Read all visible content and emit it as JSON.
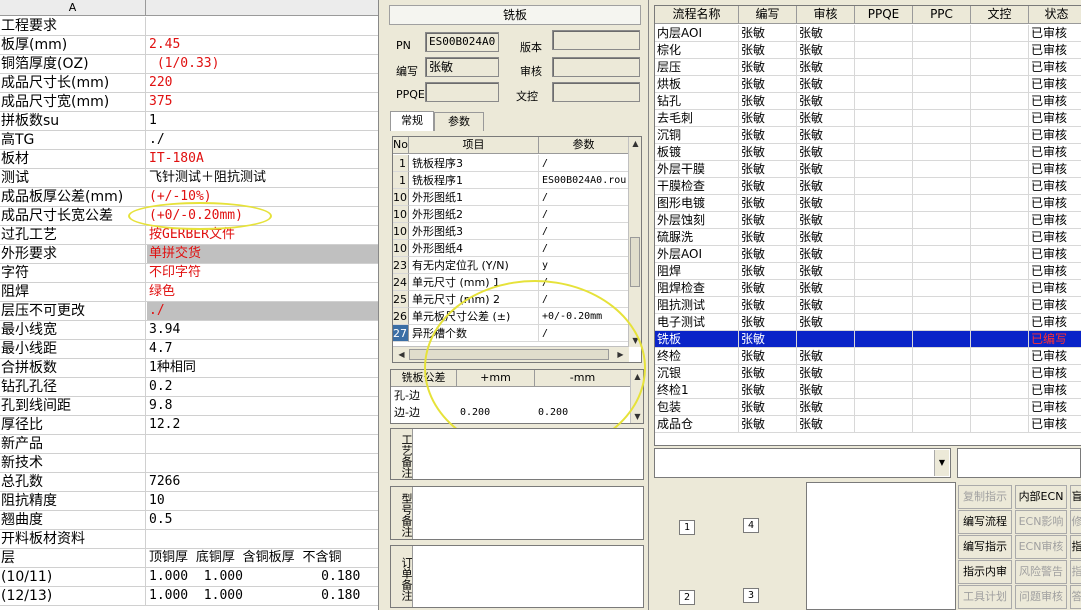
{
  "sheet": {
    "col_header": "A",
    "rows": [
      {
        "k": "工程要求",
        "v": "",
        "style": ""
      },
      {
        "k": "板厚(mm)",
        "v": "2.45",
        "style": "red"
      },
      {
        "k": "铜箔厚度(OZ)",
        "v": " (1/0.33)",
        "style": "red"
      },
      {
        "k": "成品尺寸长(mm)",
        "v": "220",
        "style": "red"
      },
      {
        "k": "成品尺寸宽(mm)",
        "v": "375",
        "style": "red"
      },
      {
        "k": "拼板数su",
        "v": "1",
        "style": ""
      },
      {
        "k": "高TG",
        "v": "./",
        "style": ""
      },
      {
        "k": "板材",
        "v": "IT-180A",
        "style": "red"
      },
      {
        "k": "测试",
        "v": "飞针测试＋阻抗测试",
        "style": ""
      },
      {
        "k": "成品板厚公差(mm)",
        "v": "(+/-10%)",
        "style": "red"
      },
      {
        "k": "成品尺寸长宽公差",
        "v": "(+0/-0.20mm)",
        "style": "red"
      },
      {
        "k": "过孔工艺",
        "v": "按GERBER文件",
        "style": "red"
      },
      {
        "k": "外形要求",
        "v": "单拼交货",
        "style": "red gray"
      },
      {
        "k": "字符",
        "v": "不印字符",
        "style": "red"
      },
      {
        "k": "阻焊",
        "v": "绿色",
        "style": "red"
      },
      {
        "k": "层压不可更改",
        "v": "./",
        "style": "red gray"
      },
      {
        "k": "最小线宽",
        "v": "3.94",
        "style": ""
      },
      {
        "k": "最小线距",
        "v": "4.7",
        "style": ""
      },
      {
        "k": "合拼板数",
        "v": "1种相同",
        "style": ""
      },
      {
        "k": "钻孔孔径",
        "v": "0.2",
        "style": ""
      },
      {
        "k": "孔到线间距",
        "v": "9.8",
        "style": ""
      },
      {
        "k": "厚径比",
        "v": "12.2",
        "style": ""
      },
      {
        "k": "新产品",
        "v": "",
        "style": ""
      },
      {
        "k": "新技术",
        "v": "",
        "style": ""
      },
      {
        "k": "总孔数",
        "v": "7266",
        "style": ""
      },
      {
        "k": "阻抗精度",
        "v": "10",
        "style": ""
      },
      {
        "k": "翘曲度",
        "v": "0.5",
        "style": ""
      },
      {
        "k": "开料板材资料",
        "v": "",
        "style": ""
      },
      {
        "k": "层",
        "v": "顶铜厚 底铜厚 含铜板厚 不含铜",
        "style": ""
      },
      {
        "k": "(10/11)",
        "v": "1.000  1.000          0.180",
        "style": ""
      },
      {
        "k": "(12/13)",
        "v": "1.000  1.000          0.180",
        "style": ""
      }
    ]
  },
  "mid": {
    "title": "铣板",
    "pn_label": "PN",
    "pn_value": "ES00B024A0",
    "version_label": "版本",
    "version_value": "",
    "writer_label": "编写",
    "writer_value": "张敏",
    "review_label": "审核",
    "review_value": "",
    "ppqe_label": "PPQE",
    "ppqe_value": "",
    "doc_label": "文控",
    "doc_value": "",
    "tabs": [
      "常规",
      "参数"
    ],
    "grid_headers": [
      "No",
      "项目",
      "参数"
    ],
    "grid_rows": [
      {
        "no": "1",
        "item": "铣板程序3",
        "param": "/"
      },
      {
        "no": "1",
        "item": "铣板程序1",
        "param": "ES00B024A0.rou"
      },
      {
        "no": "10",
        "item": "外形图纸1",
        "param": "/"
      },
      {
        "no": "10",
        "item": "外形图纸2",
        "param": "/"
      },
      {
        "no": "10",
        "item": "外形图纸3",
        "param": "/"
      },
      {
        "no": "10",
        "item": "外形图纸4",
        "param": "/"
      },
      {
        "no": "23",
        "item": "有无内定位孔 (Y/N)",
        "param": "y"
      },
      {
        "no": "24",
        "item": "单元尺寸 (mm) 1",
        "param": "/"
      },
      {
        "no": "25",
        "item": "单元尺寸 (mm) 2",
        "param": "/"
      },
      {
        "no": "26",
        "item": "单元板尺寸公差 (±)",
        "param": "+0/-0.20mm"
      },
      {
        "no": "27",
        "item": "异形槽个数",
        "param": "/"
      }
    ],
    "tol_headers": [
      "铣板公差",
      "+mm",
      "-mm"
    ],
    "tol_rows": [
      {
        "name": "孔-边",
        "plus": "",
        "minus": ""
      },
      {
        "name": "边-边",
        "plus": "0.200",
        "minus": "0.200"
      }
    ],
    "memo_labels": [
      "工艺备注",
      "型号备注",
      "订单备注"
    ]
  },
  "flow": {
    "headers": [
      "流程名称",
      "编写",
      "审核",
      "PPQE",
      "PPC",
      "文控",
      "状态"
    ],
    "rows": [
      {
        "name": "内层AOI",
        "w": "张敏",
        "r": "张敏",
        "st": "已审核"
      },
      {
        "name": "棕化",
        "w": "张敏",
        "r": "张敏",
        "st": "已审核"
      },
      {
        "name": "层压",
        "w": "张敏",
        "r": "张敏",
        "st": "已审核"
      },
      {
        "name": "烘板",
        "w": "张敏",
        "r": "张敏",
        "st": "已审核"
      },
      {
        "name": "钻孔",
        "w": "张敏",
        "r": "张敏",
        "st": "已审核"
      },
      {
        "name": "去毛刺",
        "w": "张敏",
        "r": "张敏",
        "st": "已审核"
      },
      {
        "name": "沉铜",
        "w": "张敏",
        "r": "张敏",
        "st": "已审核"
      },
      {
        "name": "板镀",
        "w": "张敏",
        "r": "张敏",
        "st": "已审核"
      },
      {
        "name": "外层干膜",
        "w": "张敏",
        "r": "张敏",
        "st": "已审核"
      },
      {
        "name": "干膜检查",
        "w": "张敏",
        "r": "张敏",
        "st": "已审核"
      },
      {
        "name": "图形电镀",
        "w": "张敏",
        "r": "张敏",
        "st": "已审核"
      },
      {
        "name": "外层蚀刻",
        "w": "张敏",
        "r": "张敏",
        "st": "已审核"
      },
      {
        "name": "硫脲洗",
        "w": "张敏",
        "r": "张敏",
        "st": "已审核"
      },
      {
        "name": "外层AOI",
        "w": "张敏",
        "r": "张敏",
        "st": "已审核"
      },
      {
        "name": "阻焊",
        "w": "张敏",
        "r": "张敏",
        "st": "已审核"
      },
      {
        "name": "阻焊检查",
        "w": "张敏",
        "r": "张敏",
        "st": "已审核"
      },
      {
        "name": "阻抗测试",
        "w": "张敏",
        "r": "张敏",
        "st": "已审核"
      },
      {
        "name": "电子测试",
        "w": "张敏",
        "r": "张敏",
        "st": "已审核"
      },
      {
        "name": "铣板",
        "w": "张敏",
        "r": "",
        "st": "已编写",
        "sel": true
      },
      {
        "name": "终检",
        "w": "张敏",
        "r": "张敏",
        "st": "已审核"
      },
      {
        "name": "沉银",
        "w": "张敏",
        "r": "张敏",
        "st": "已审核"
      },
      {
        "name": "终检1",
        "w": "张敏",
        "r": "张敏",
        "st": "已审核"
      },
      {
        "name": "包装",
        "w": "张敏",
        "r": "张敏",
        "st": "已审核"
      },
      {
        "name": "成品仓",
        "w": "张敏",
        "r": "张敏",
        "st": "已审核"
      }
    ]
  },
  "bottom": {
    "numbers": [
      "1",
      "4",
      "2",
      "3"
    ],
    "buttons": [
      {
        "label": "复制指示",
        "dis": true
      },
      {
        "label": "内部ECN",
        "dis": false
      },
      {
        "label": "盲",
        "dis": false
      },
      {
        "label": "编写流程",
        "dis": false
      },
      {
        "label": "ECN影响",
        "dis": true
      },
      {
        "label": "修",
        "dis": true
      },
      {
        "label": "编写指示",
        "dis": false
      },
      {
        "label": "ECN审核",
        "dis": true
      },
      {
        "label": "指",
        "dis": false
      },
      {
        "label": "指示内审",
        "dis": false
      },
      {
        "label": "风险警告",
        "dis": true
      },
      {
        "label": "指",
        "dis": true
      },
      {
        "label": "工具计划",
        "dis": true
      },
      {
        "label": "问题审核",
        "dis": true
      },
      {
        "label": "答",
        "dis": true
      }
    ]
  },
  "colors": {
    "selected_row": "#0a24c8",
    "annotation": "#e6e23a",
    "red_text": "#e01010"
  }
}
